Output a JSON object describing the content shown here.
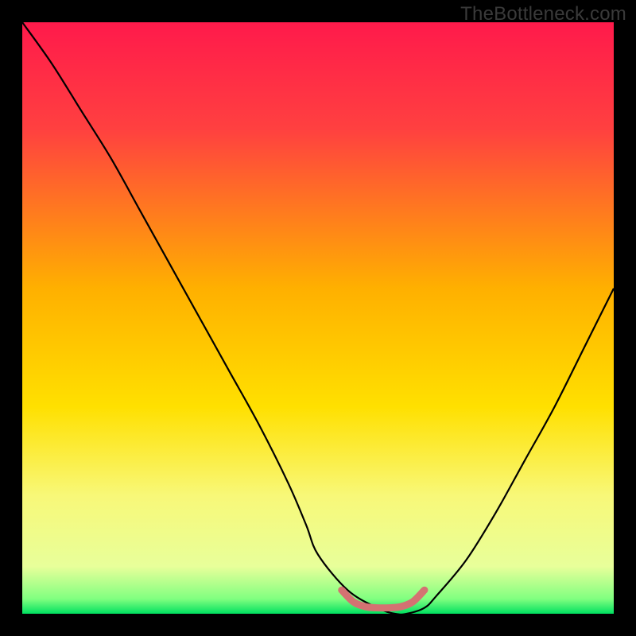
{
  "watermark": "TheBottleneck.com",
  "chart_data": {
    "type": "line",
    "title": "",
    "xlabel": "",
    "ylabel": "",
    "xlim": [
      0,
      100
    ],
    "ylim": [
      0,
      100
    ],
    "grid": false,
    "legend": false,
    "background_gradient": {
      "stops": [
        {
          "offset": 0.0,
          "color": "#ff1a4b"
        },
        {
          "offset": 0.18,
          "color": "#ff4040"
        },
        {
          "offset": 0.45,
          "color": "#ffb000"
        },
        {
          "offset": 0.65,
          "color": "#ffe000"
        },
        {
          "offset": 0.8,
          "color": "#f8f878"
        },
        {
          "offset": 0.92,
          "color": "#e8ff9a"
        },
        {
          "offset": 0.975,
          "color": "#80ff80"
        },
        {
          "offset": 1.0,
          "color": "#00e060"
        }
      ]
    },
    "series": [
      {
        "name": "bottleneck-curve",
        "stroke": "#000000",
        "stroke_width": 2.2,
        "x": [
          0,
          5,
          10,
          15,
          20,
          25,
          30,
          35,
          40,
          45,
          48,
          50,
          55,
          60,
          63,
          65,
          68,
          70,
          75,
          80,
          85,
          90,
          95,
          100
        ],
        "y": [
          100,
          93,
          85,
          77,
          68,
          59,
          50,
          41,
          32,
          22,
          15,
          10,
          4,
          1,
          0,
          0,
          1,
          3,
          9,
          17,
          26,
          35,
          45,
          55
        ]
      },
      {
        "name": "sweet-spot-band",
        "stroke": "#d47272",
        "stroke_width": 9,
        "linecap": "round",
        "x": [
          54,
          56,
          58,
          60,
          62,
          64,
          66,
          68
        ],
        "y": [
          4,
          2,
          1.2,
          1,
          1,
          1.2,
          2,
          4
        ]
      }
    ]
  }
}
